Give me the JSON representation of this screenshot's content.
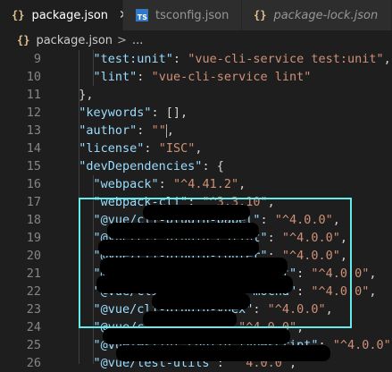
{
  "tabs": [
    {
      "label": "package.json",
      "icon": "{}",
      "active": true,
      "close": "✕"
    },
    {
      "label": "tsconfig.json",
      "icon": "TS",
      "active": false
    },
    {
      "label": "package-lock.json",
      "icon": "{}",
      "active": false
    }
  ],
  "breadcrumb": {
    "icon": "{}",
    "file": "package.json",
    "separator": ">",
    "tail": "..."
  },
  "editor": {
    "lines": [
      {
        "num": "9",
        "text": "    \"test:unit\": \"vue-cli-service test:unit\","
      },
      {
        "num": "10",
        "text": "    \"lint\": \"vue-cli-service lint\""
      },
      {
        "num": "11",
        "text": "  },"
      },
      {
        "num": "12",
        "text": "  \"keywords\": [],"
      },
      {
        "num": "13",
        "text": "  \"author\": \"\","
      },
      {
        "num": "14",
        "text": "  \"license\": \"ISC\","
      },
      {
        "num": "15",
        "text": "  \"devDependencies\": {"
      },
      {
        "num": "16",
        "text": "    \"webpack\": \"^4.41.2\","
      },
      {
        "num": "17",
        "text": "    \"webpack-cli\": \"^3.3.10\","
      },
      {
        "num": "18",
        "text": "    \"@vue/cli-plugin-babel\": \"^4.0.0\","
      },
      {
        "num": "19",
        "text": "    \"@vue/cli-plugin-eslint\": \"^4.0.0\","
      },
      {
        "num": "20",
        "text": "    \"@vue/cli-plugin-router\": \"^4.0.0\","
      },
      {
        "num": "21",
        "text": "    \"@vue/cli-plugin-typescript\": \"^4.0.0\","
      },
      {
        "num": "22",
        "text": "    \"@vue/cli-plugin-unit-mocha\": \"^4.0.0\","
      },
      {
        "num": "23",
        "text": "    \"@vue/cli-plugin-vuex\": \"^4.0.0\","
      },
      {
        "num": "24",
        "text": "    \"@vue/cli-service\": \"^4.0.0\","
      },
      {
        "num": "25",
        "text": "    \"@vue/eslint-config-typescript\": \"^4.0.0\","
      },
      {
        "num": "26",
        "text": "    \"@vue/test-utils\": \"^4.0.0\","
      }
    ]
  },
  "colors": {
    "key": "#9cdcfe",
    "string": "#ce9178",
    "highlight_border": "#66ebeb"
  }
}
